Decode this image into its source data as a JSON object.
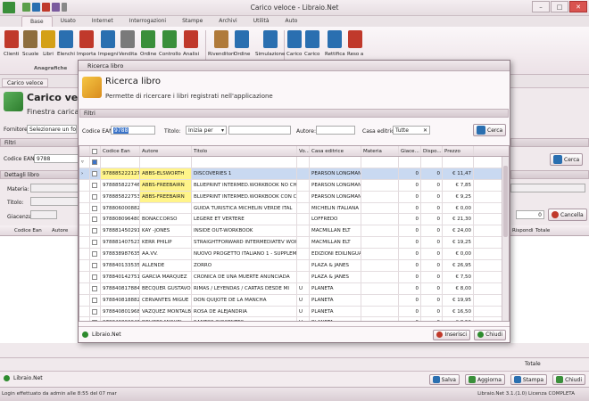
{
  "app": {
    "title": "Carico veloce - Libraio.Net"
  },
  "ribbon": {
    "tabs": [
      "Base",
      "Usato",
      "Internet",
      "Interrogazioni",
      "Stampe",
      "Archivi",
      "Utilità",
      "Auto"
    ],
    "buttons": [
      {
        "label": "Clienti",
        "color": "#c0392b"
      },
      {
        "label": "Scuole",
        "color": "#8e6e3e"
      },
      {
        "label": "Libri",
        "color": "#d4a017"
      },
      {
        "label": "Elenchi",
        "color": "#2a6fb0"
      },
      {
        "label": "Importa",
        "color": "#c0392b"
      },
      {
        "label": "Impegni",
        "color": "#2a6fb0"
      },
      {
        "label": "Vendita",
        "color": "#7a7a7a"
      },
      {
        "label": "Ordine",
        "color": "#3a8f3a"
      },
      {
        "label": "Controllo",
        "color": "#3a8f3a"
      },
      {
        "label": "Analisi",
        "color": "#c0392b"
      },
      {
        "label": "Rivenditori",
        "color": "#b07a3a"
      },
      {
        "label": "Ordine",
        "color": "#2a6fb0"
      },
      {
        "label": "Simulazione",
        "color": "#2a6fb0"
      },
      {
        "label": "Carico",
        "color": "#2a6fb0"
      },
      {
        "label": "Carico",
        "color": "#2a6fb0"
      },
      {
        "label": "Rettifica",
        "color": "#2a6fb0"
      },
      {
        "label": "Reso a",
        "color": "#c0392b"
      }
    ],
    "group_label": "Anagrafiche"
  },
  "doc_tab": "Carico veloce",
  "background": {
    "header_title": "Carico veloce",
    "header_sub": "Finestra caricare l",
    "fornitore_label": "Fornitore:",
    "fornitore_value": "Selezionare un fornitor",
    "filtri": "Filtri",
    "codice_ean_label": "Codice EAN:",
    "codice_ean_value": "9788",
    "cerca": "Cerca",
    "dettagli": "Dettagli libro",
    "materia": "Materia:",
    "titolo": "Titolo:",
    "giacenza": "Giacenza:",
    "qty": "0",
    "cancella": "Cancella",
    "cols": [
      "Codice Ean",
      "Autore"
    ],
    "cols_right": [
      "Rispondi...",
      "Totale"
    ],
    "totale": "Totale",
    "footer": "Libraio.Net",
    "actions": [
      "Salva",
      "Aggiorna",
      "Stampa",
      "Chiudi"
    ]
  },
  "dialog": {
    "title": "Ricerca libro",
    "heading": "Ricerca libro",
    "subheading": "Permette di ricercare i libri registrati nell'applicazione",
    "filtri": "Filtri",
    "ean_label": "Codice EAN:",
    "ean_value": "9788",
    "titolo_label": "Titolo:",
    "titolo_mode": "Inizia per",
    "autore_label": "Autore:",
    "casa_label": "Casa editrice:",
    "casa_value": "Tutte",
    "cerca": "Cerca",
    "footer": "Libraio.Net",
    "inserisci": "Inserisci",
    "chiudi": "Chiudi",
    "columns": [
      "Codice Ean",
      "Autore",
      "Titolo",
      "Vo...",
      "Casa editrice",
      "Materia",
      "Giace...",
      "Dispo...",
      "Prezzo"
    ],
    "rows": [
      [
        "9788852221275",
        "ABBS-ELSWORTH",
        "DISCOVERIES 1",
        "",
        "PEARSON LONGMAN",
        "",
        "0",
        "0",
        "€ 11,47"
      ],
      [
        "9788858227465",
        "ABBS-FREEBAIRN",
        "BLUEPRINT INTERMED.WORKBOOK NO CHIAVE",
        "",
        "PEARSON LONGMAN",
        "",
        "0",
        "0",
        "€ 7,85"
      ],
      [
        "9788858227532",
        "ABBS-FREEBAIRN",
        "BLUEPRINT INTERMED.WORKBOOK CON CHIAVE",
        "",
        "PEARSON LONGMAN",
        "",
        "0",
        "0",
        "€ 9,25"
      ],
      [
        "9788060008822",
        "",
        "GUIDA TURISTICA MICHELIN VERDE ITAL",
        "",
        "MICHELIN ITALIANA",
        "",
        "0",
        "0",
        "€ 0,00"
      ],
      [
        "9788080964801",
        "BONACCORSO",
        "LEGERE ET VERTERE",
        "",
        "LOFFREDO",
        "",
        "0",
        "0",
        "€ 21,30"
      ],
      [
        "9788814502912",
        "KAY -JONES",
        "INSIDE OUT-WORKBOOK",
        "",
        "MACMILLAN ELT",
        "",
        "0",
        "0",
        "€ 24,00"
      ],
      [
        "9788814075237",
        "KERR PHILIP",
        "STRAIGHTFORWARD INTERMEDIATEV WORKB",
        "",
        "MACMILLAN ELT",
        "",
        "0",
        "0",
        "€ 19,25"
      ],
      [
        "9788389876355",
        "AA.VV.",
        "NUOVO PROGETTO ITALIANO 1 - SUPPLEMEN...",
        "",
        "EDIZIONI EDILINGUA",
        "",
        "0",
        "0",
        "€ 0,00"
      ],
      [
        "9788401335356",
        "ALLENDE",
        "ZORRO",
        "",
        "PLAZA & JANES",
        "",
        "0",
        "0",
        "€ 26,95"
      ],
      [
        "9788401427510",
        "GARCIA MARQUEZ",
        "CRONICA DE UNA MUERTE ANUNCIADA",
        "",
        "PLAZA & JANES",
        "",
        "0",
        "0",
        "€ 7,50"
      ],
      [
        "9788408178844",
        "BECQUER GUSTAVO",
        "RIMAS / LEYENDAS / CARTAS DESDE MI",
        "U",
        "PLANETA",
        "",
        "0",
        "0",
        "€ 8,00"
      ],
      [
        "9788408188827",
        "CERVANTES MIGUE",
        "DON QUIJOTE DE LA MANCHA",
        "U",
        "PLANETA",
        "",
        "0",
        "0",
        "€ 19,95"
      ],
      [
        "9788408019688",
        "VAZQUEZ MONTALB",
        "ROSA DE ALEJANDRIA",
        "U",
        "PLANETA",
        "",
        "0",
        "0",
        "€ 16,50"
      ],
      [
        "9788408020479",
        "DELIBES MIGUEL",
        "SANTOS INOCENTES",
        "U",
        "PLANETA",
        "",
        "0",
        "0",
        "€ 8,50"
      ]
    ]
  },
  "status": {
    "left": "Login effettuato da admin alle 8:55 del 07 mar",
    "right": "Libraio.Net 3.1.(1.0) Licenza COMPLETA"
  }
}
